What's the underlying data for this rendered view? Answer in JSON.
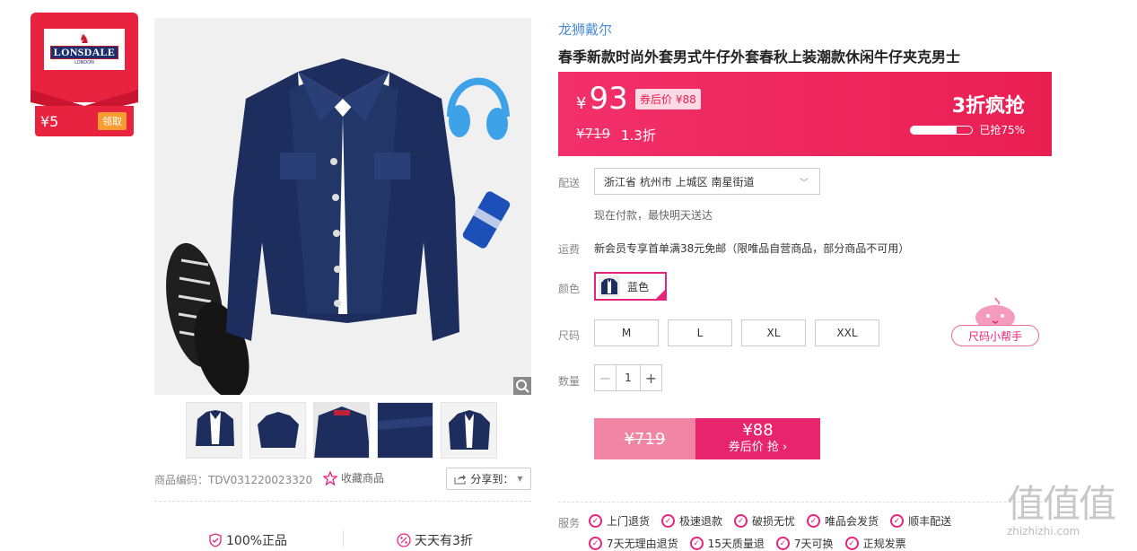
{
  "coupon": {
    "brand": "LONSDALE",
    "brand_sub": "LONDON",
    "value": "¥5",
    "claim_label": "领取"
  },
  "product": {
    "brand": "龙狮戴尔",
    "title": "春季新款时尚外套男式牛仔外套春秋上装潮款休闲牛仔夹克男士",
    "code": "商品编码：TDV031220023320",
    "favorite_label": "收藏商品",
    "share_label": "分享到："
  },
  "price": {
    "currency": "¥",
    "current": "93",
    "after_coupon_label": "券后价 ¥88",
    "original": "¥719",
    "discount": "1.3折",
    "flash_label": "3折疯抢",
    "sold_pct": 75,
    "sold_text": "已抢75%"
  },
  "delivery": {
    "label": "配送",
    "address": "浙江省 杭州市 上城区 南星街道",
    "note": "现在付款，最快明天送达"
  },
  "shipping": {
    "label": "运费",
    "text": "新会员专享首单满38元免邮（限唯品自营商品，部分商品不可用）"
  },
  "color": {
    "label": "颜色",
    "selected": "蓝色"
  },
  "size": {
    "label": "尺码",
    "options": [
      "M",
      "L",
      "XL",
      "XXL"
    ],
    "helper_label": "尺码小帮手"
  },
  "quantity": {
    "label": "数量",
    "value": "1",
    "minus": "−",
    "plus": "+"
  },
  "buy": {
    "orig_price": "¥719",
    "coupon_price": "¥88",
    "coupon_action": "券后价 抢 ›"
  },
  "assurance": {
    "genuine": "100%正品",
    "daily": "天天有3折"
  },
  "services": {
    "label": "服务",
    "row1": [
      "上门退货",
      "极速退款",
      "破损无忧",
      "唯品会发货",
      "顺丰配送"
    ],
    "row2": [
      "7天无理由退货",
      "15天质量退",
      "7天可换",
      "正规发票"
    ]
  },
  "watermark": {
    "cn": "值值值",
    "en": "zhizhizhi.com"
  },
  "colors": {
    "accent": "#e8237c",
    "price_bg": "#f2306a",
    "coupon_red": "#e8233f",
    "link_blue": "#4a8ad6"
  }
}
